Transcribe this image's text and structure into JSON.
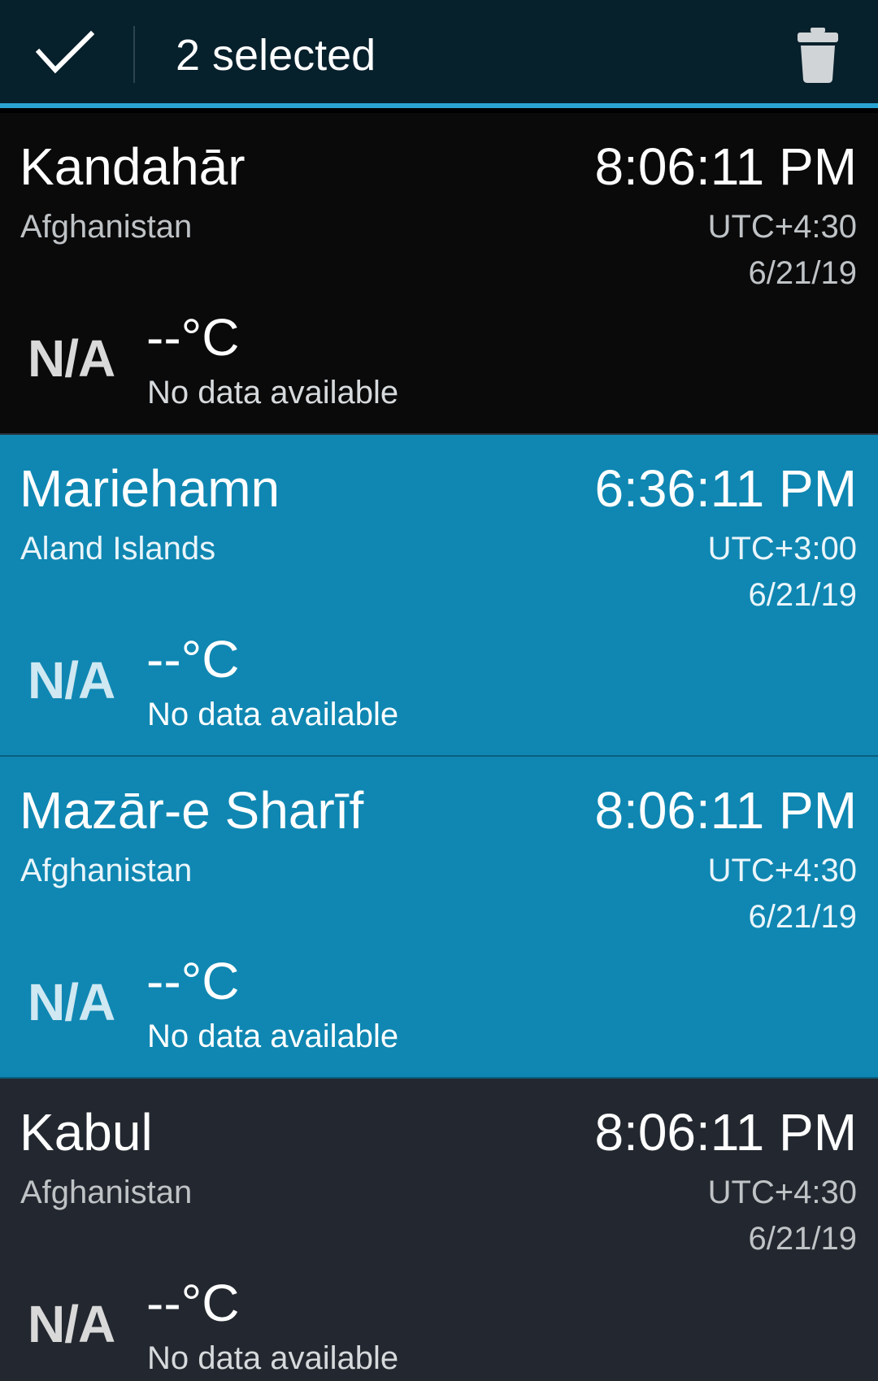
{
  "action_bar": {
    "selected_text": "2 selected",
    "done_icon": "checkmark-icon",
    "delete_icon": "trash-icon",
    "accent_color": "#2aa3d3",
    "background_color": "#06202c"
  },
  "cities": [
    {
      "name": "Kandahār",
      "country": "Afghanistan",
      "time": "8:06:11 PM",
      "utc_offset": "UTC+4:30",
      "date": "6/21/19",
      "weather_icon_text": "N/A",
      "temperature": "--°C",
      "condition": "No data available",
      "selected": false
    },
    {
      "name": "Mariehamn",
      "country": "Aland Islands",
      "time": "6:36:11 PM",
      "utc_offset": "UTC+3:00",
      "date": "6/21/19",
      "weather_icon_text": "N/A",
      "temperature": "--°C",
      "condition": "No data available",
      "selected": true
    },
    {
      "name": "Mazār-e Sharīf",
      "country": "Afghanistan",
      "time": "8:06:11 PM",
      "utc_offset": "UTC+4:30",
      "date": "6/21/19",
      "weather_icon_text": "N/A",
      "temperature": "--°C",
      "condition": "No data available",
      "selected": true
    },
    {
      "name": "Kabul",
      "country": "Afghanistan",
      "time": "8:06:11 PM",
      "utc_offset": "UTC+4:30",
      "date": "6/21/19",
      "weather_icon_text": "N/A",
      "temperature": "--°C",
      "condition": "No data available",
      "selected": false
    }
  ],
  "colors": {
    "selected_row": "#0f87b2",
    "normal_row": "#0a0a0b",
    "alt_row": "#232830"
  }
}
